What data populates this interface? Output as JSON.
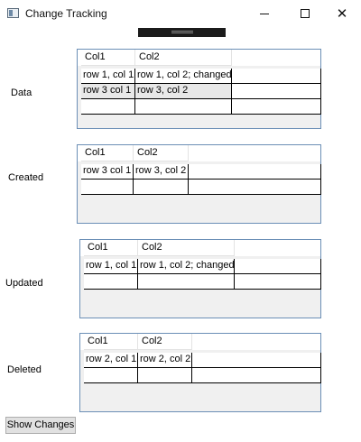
{
  "window": {
    "title": "Change Tracking",
    "minimize_icon": "minimize-icon",
    "maximize_icon": "maximize-icon",
    "close_icon": "close-icon",
    "close_glyph": "✕"
  },
  "sections": [
    {
      "label": "Data",
      "columns": [
        "Col1",
        "Col2"
      ],
      "rows": [
        [
          "row 1, col 1",
          "row 1, col 2; changed"
        ],
        [
          "row 3 col 1",
          "row 3, col 2"
        ]
      ]
    },
    {
      "label": "Created",
      "columns": [
        "Col1",
        "Col2"
      ],
      "rows": [
        [
          "row 3 col 1",
          "row 3, col 2"
        ]
      ]
    },
    {
      "label": "Updated",
      "columns": [
        "Col1",
        "Col2"
      ],
      "rows": [
        [
          "row 1, col 1",
          "row 1, col 2; changed"
        ]
      ]
    },
    {
      "label": "Deleted",
      "columns": [
        "Col1",
        "Col2"
      ],
      "rows": [
        [
          "row 2, col 1",
          "row 2, col 2"
        ]
      ]
    }
  ],
  "actions": {
    "show_changes_label": "Show Changes"
  }
}
